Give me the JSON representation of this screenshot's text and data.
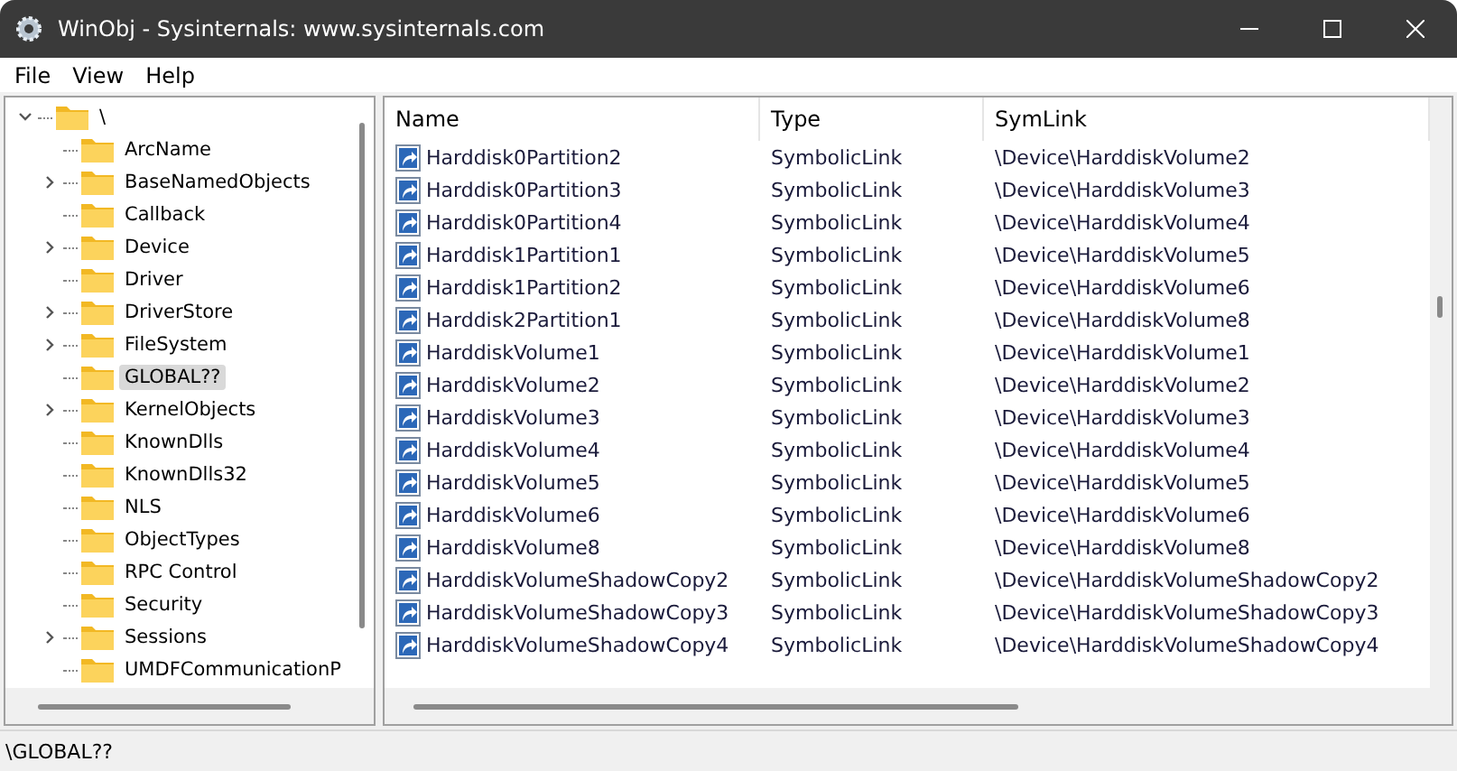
{
  "window": {
    "title": "WinObj - Sysinternals: www.sysinternals.com"
  },
  "menu": [
    "File",
    "View",
    "Help"
  ],
  "tree": {
    "label": "\\",
    "expanded": true,
    "selected": false,
    "children": [
      {
        "label": "ArcName",
        "has_children": false,
        "selected": false
      },
      {
        "label": "BaseNamedObjects",
        "has_children": true,
        "selected": false
      },
      {
        "label": "Callback",
        "has_children": false,
        "selected": false
      },
      {
        "label": "Device",
        "has_children": true,
        "selected": false
      },
      {
        "label": "Driver",
        "has_children": false,
        "selected": false
      },
      {
        "label": "DriverStore",
        "has_children": true,
        "selected": false
      },
      {
        "label": "FileSystem",
        "has_children": true,
        "selected": false
      },
      {
        "label": "GLOBAL??",
        "has_children": false,
        "selected": true
      },
      {
        "label": "KernelObjects",
        "has_children": true,
        "selected": false
      },
      {
        "label": "KnownDlls",
        "has_children": false,
        "selected": false
      },
      {
        "label": "KnownDlls32",
        "has_children": false,
        "selected": false
      },
      {
        "label": "NLS",
        "has_children": false,
        "selected": false
      },
      {
        "label": "ObjectTypes",
        "has_children": false,
        "selected": false
      },
      {
        "label": "RPC Control",
        "has_children": false,
        "selected": false
      },
      {
        "label": "Security",
        "has_children": false,
        "selected": false
      },
      {
        "label": "Sessions",
        "has_children": true,
        "selected": false
      },
      {
        "label": "UMDFCommunicationP",
        "has_children": false,
        "selected": false
      }
    ]
  },
  "table": {
    "columns": [
      "Name",
      "Type",
      "SymLink"
    ],
    "rows": [
      [
        "Harddisk0Partition2",
        "SymbolicLink",
        "\\Device\\HarddiskVolume2"
      ],
      [
        "Harddisk0Partition3",
        "SymbolicLink",
        "\\Device\\HarddiskVolume3"
      ],
      [
        "Harddisk0Partition4",
        "SymbolicLink",
        "\\Device\\HarddiskVolume4"
      ],
      [
        "Harddisk1Partition1",
        "SymbolicLink",
        "\\Device\\HarddiskVolume5"
      ],
      [
        "Harddisk1Partition2",
        "SymbolicLink",
        "\\Device\\HarddiskVolume6"
      ],
      [
        "Harddisk2Partition1",
        "SymbolicLink",
        "\\Device\\HarddiskVolume8"
      ],
      [
        "HarddiskVolume1",
        "SymbolicLink",
        "\\Device\\HarddiskVolume1"
      ],
      [
        "HarddiskVolume2",
        "SymbolicLink",
        "\\Device\\HarddiskVolume2"
      ],
      [
        "HarddiskVolume3",
        "SymbolicLink",
        "\\Device\\HarddiskVolume3"
      ],
      [
        "HarddiskVolume4",
        "SymbolicLink",
        "\\Device\\HarddiskVolume4"
      ],
      [
        "HarddiskVolume5",
        "SymbolicLink",
        "\\Device\\HarddiskVolume5"
      ],
      [
        "HarddiskVolume6",
        "SymbolicLink",
        "\\Device\\HarddiskVolume6"
      ],
      [
        "HarddiskVolume8",
        "SymbolicLink",
        "\\Device\\HarddiskVolume8"
      ],
      [
        "HarddiskVolumeShadowCopy2",
        "SymbolicLink",
        "\\Device\\HarddiskVolumeShadowCopy2"
      ],
      [
        "HarddiskVolumeShadowCopy3",
        "SymbolicLink",
        "\\Device\\HarddiskVolumeShadowCopy3"
      ],
      [
        "HarddiskVolumeShadowCopy4",
        "SymbolicLink",
        "\\Device\\HarddiskVolumeShadowCopy4"
      ]
    ]
  },
  "status_bar": "\\GLOBAL??"
}
